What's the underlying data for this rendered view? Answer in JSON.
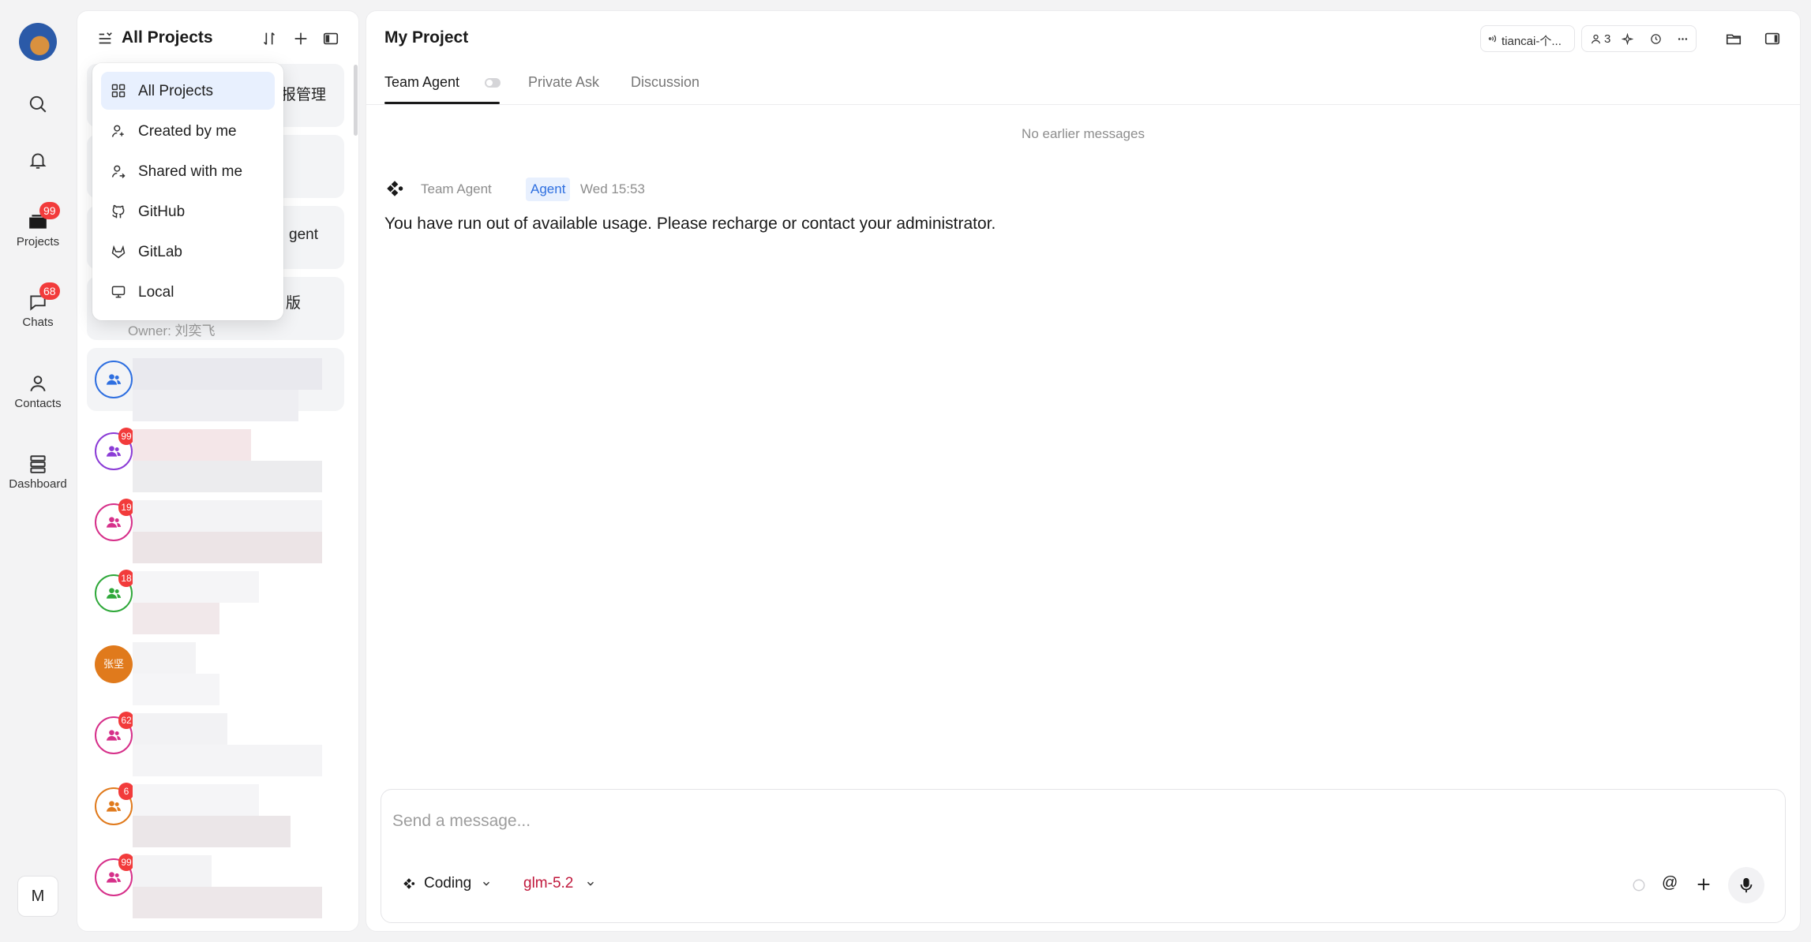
{
  "rail": {
    "items": [
      {
        "label": "",
        "icon": "search-icon"
      },
      {
        "label": "",
        "icon": "bell-icon"
      },
      {
        "label": "Projects",
        "icon": "folder-icon",
        "badge": "99"
      },
      {
        "label": "Chats",
        "icon": "chat-icon",
        "badge": "68"
      },
      {
        "label": "Contacts",
        "icon": "person-icon"
      },
      {
        "label": "Dashboard",
        "icon": "stack-icon"
      }
    ],
    "bottom_button": "M"
  },
  "projects_panel": {
    "title": "All Projects",
    "cards": [
      {
        "text": "报管理"
      },
      {
        "text": ""
      },
      {
        "text": "gent"
      },
      {
        "text": "版",
        "sub": "Owner: 刘奕飞"
      }
    ],
    "orange_avatar_text": "张坚",
    "badges": [
      "99",
      "19",
      "18",
      "62",
      "6",
      "99"
    ]
  },
  "dropdown": {
    "items": [
      {
        "label": "All Projects",
        "icon": "grid-icon",
        "active": true
      },
      {
        "label": "Created by me",
        "icon": "user-plus-icon"
      },
      {
        "label": "Shared with me",
        "icon": "user-share-icon"
      },
      {
        "label": "GitHub",
        "icon": "github-icon"
      },
      {
        "label": "GitLab",
        "icon": "gitlab-icon"
      },
      {
        "label": "Local",
        "icon": "monitor-icon"
      }
    ]
  },
  "main": {
    "title": "My Project",
    "topbar": {
      "channel_label": "tiancai-个...",
      "member_count": "3"
    },
    "tabs": [
      "Team Agent",
      "Private Ask",
      "Discussion"
    ],
    "no_earlier": "No earlier messages",
    "message": {
      "sender": "Team Agent",
      "tag": "Agent",
      "time": "Wed 15:53",
      "body": "You have run out of available usage. Please recharge or contact your administrator."
    },
    "composer": {
      "placeholder": "Send a message...",
      "mode": "Coding",
      "model": "glm-5.2",
      "at_symbol": "@"
    }
  },
  "colors": {
    "accent": "#2e6fe0",
    "badge": "#f23b3b",
    "model_text": "#c0183c"
  }
}
